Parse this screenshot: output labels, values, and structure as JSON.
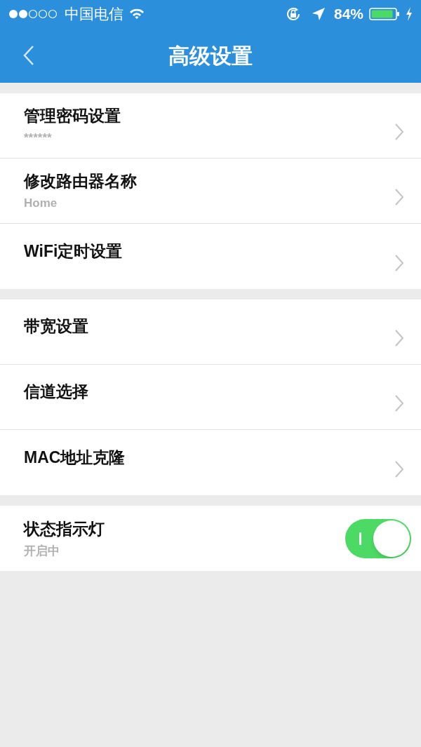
{
  "status_bar": {
    "carrier": "中国电信",
    "battery": "84%"
  },
  "nav": {
    "title": "高级设置"
  },
  "sections": [
    {
      "items": [
        {
          "kind": "link",
          "title": "管理密码设置",
          "subtitle": "******"
        },
        {
          "kind": "link",
          "title": "修改路由器名称",
          "subtitle": "Home"
        },
        {
          "kind": "link",
          "title": "WiFi定时设置"
        }
      ]
    },
    {
      "items": [
        {
          "kind": "link",
          "title": "带宽设置"
        },
        {
          "kind": "link",
          "title": "信道选择"
        },
        {
          "kind": "link",
          "title": "MAC地址克隆"
        }
      ]
    },
    {
      "items": [
        {
          "kind": "toggle",
          "title": "状态指示灯",
          "subtitle": "开启中",
          "on": true
        }
      ]
    }
  ]
}
